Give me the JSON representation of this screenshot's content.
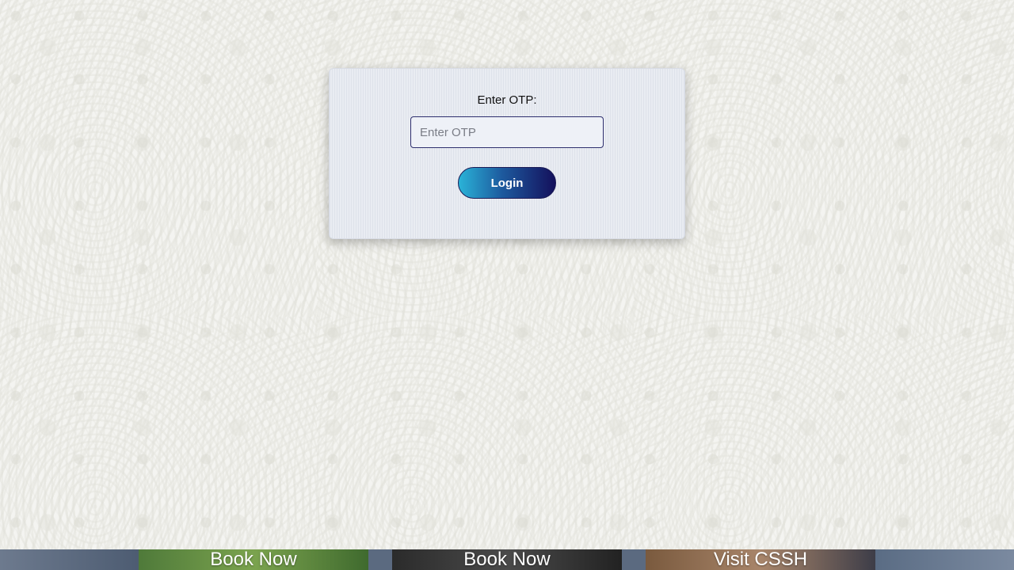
{
  "login_card": {
    "otp_label": "Enter OTP:",
    "otp_placeholder": "Enter OTP",
    "otp_value": "",
    "login_label": "Login"
  },
  "promo_bar": {
    "items": [
      {
        "label": "Book Now"
      },
      {
        "label": "Book Now"
      },
      {
        "label": "Visit CSSH"
      }
    ]
  },
  "colors": {
    "background": "#f4f4f1",
    "card": "#e9ecf2",
    "input_border": "#2e2f6e",
    "button_gradient_start": "#2ab3d8",
    "button_gradient_end": "#14105c"
  }
}
